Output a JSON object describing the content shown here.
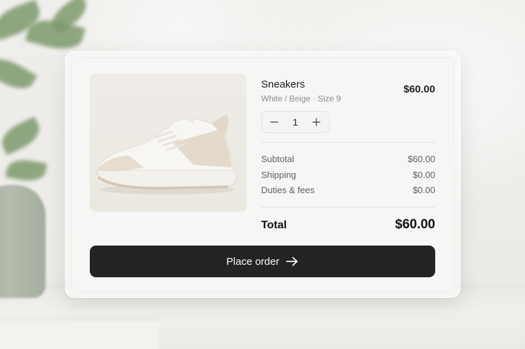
{
  "product": {
    "name": "Sneakers",
    "variant": "White / Beige · Size 9",
    "price": "$60.00",
    "quantity": "1",
    "image_icon": "sneaker-image"
  },
  "stepper": {
    "decrement_icon": "minus-icon",
    "increment_icon": "plus-icon"
  },
  "summary": {
    "rows": [
      {
        "label": "Subtotal",
        "value": "$60.00"
      },
      {
        "label": "Shipping",
        "value": "$0.00"
      },
      {
        "label": "Duties & fees",
        "value": "$0.00"
      }
    ],
    "total_label": "Total",
    "total_value": "$60.00"
  },
  "cta": {
    "label": "Place order",
    "icon": "arrow-right-icon"
  },
  "colors": {
    "button_bg": "#232323",
    "card_bg": "#f6f6f5",
    "muted_text": "#8c8c8c"
  }
}
